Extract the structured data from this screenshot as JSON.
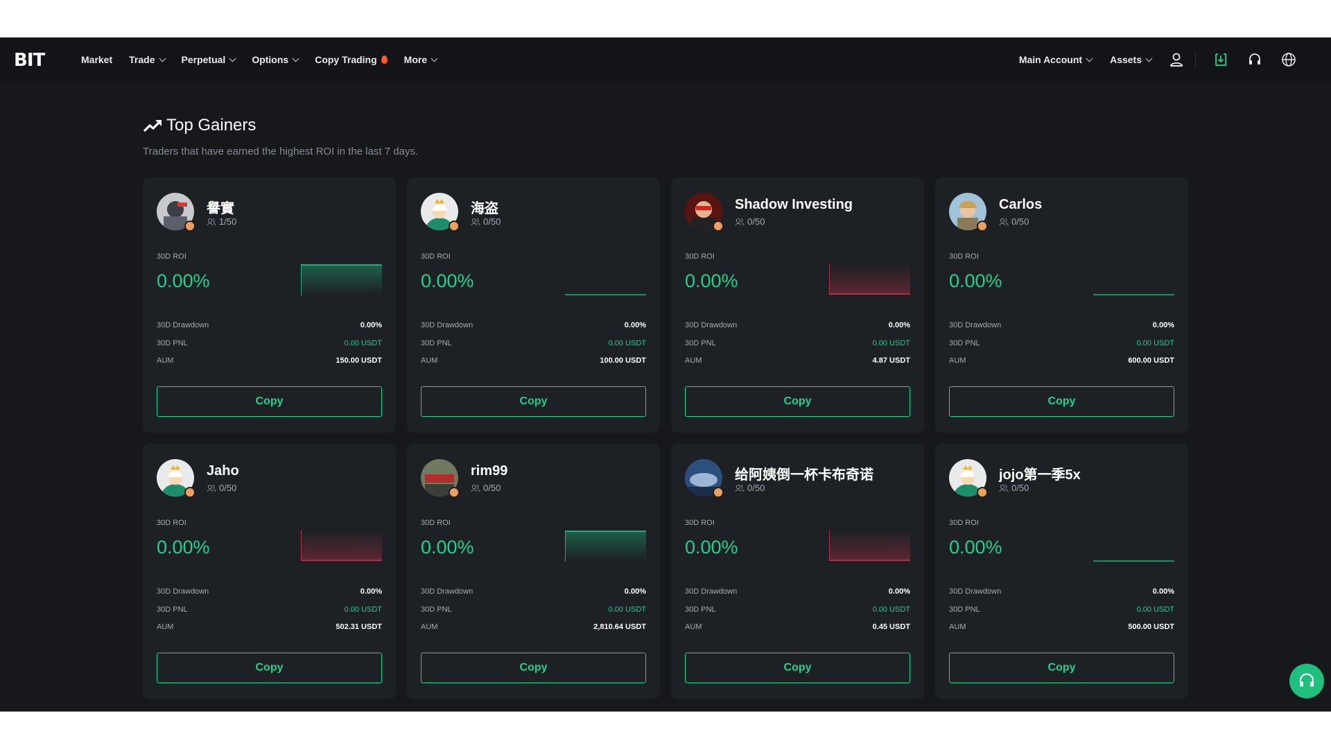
{
  "nav": {
    "logo": "BIT",
    "items": [
      {
        "label": "Market",
        "dropdown": false
      },
      {
        "label": "Trade",
        "dropdown": true
      },
      {
        "label": "Perpetual",
        "dropdown": true
      },
      {
        "label": "Options",
        "dropdown": true
      },
      {
        "label": "Copy Trading",
        "dropdown": false,
        "hot": true
      },
      {
        "label": "More",
        "dropdown": true
      }
    ],
    "right": {
      "main_account": "Main Account",
      "assets": "Assets"
    },
    "icons": [
      "user-icon",
      "deposit-icon",
      "headset-icon",
      "globe-icon"
    ]
  },
  "section": {
    "title": "Top Gainers",
    "subtitle": "Traders that have earned the highest ROI in the last 7 days."
  },
  "labels": {
    "roi": "30D ROI",
    "drawdown": "30D Drawdown",
    "pnl": "30D PNL",
    "aum": "AUM",
    "copy": "Copy"
  },
  "colors": {
    "accent": "#1fd28e",
    "negative": "#d0354c",
    "background": "#16181c",
    "card": "#1d2025"
  },
  "traders": [
    {
      "name": "譽實",
      "followers": "1/50",
      "roi": "0.00%",
      "drawdown": "0.00%",
      "pnl": "0.00 USDT",
      "aum": "150.00 USDT",
      "trend": "up",
      "avatar": "photo-avatar-dark"
    },
    {
      "name": "海盗",
      "followers": "0/50",
      "roi": "0.00%",
      "drawdown": "0.00%",
      "pnl": "0.00 USDT",
      "aum": "100.00 USDT",
      "trend": "flat",
      "avatar": "default-avatar"
    },
    {
      "name": "Shadow Investing",
      "followers": "0/50",
      "roi": "0.00%",
      "drawdown": "0.00%",
      "pnl": "0.00 USDT",
      "aum": "4.87 USDT",
      "trend": "down",
      "avatar": "photo-avatar-red"
    },
    {
      "name": "Carlos",
      "followers": "0/50",
      "roi": "0.00%",
      "drawdown": "0.00%",
      "pnl": "0.00 USDT",
      "aum": "600.00 USDT",
      "trend": "flat",
      "avatar": "photo-avatar-light"
    },
    {
      "name": "Jaho",
      "followers": "0/50",
      "roi": "0.00%",
      "drawdown": "0.00%",
      "pnl": "0.00 USDT",
      "aum": "502.31 USDT",
      "trend": "down",
      "avatar": "default-avatar"
    },
    {
      "name": "rim99",
      "followers": "0/50",
      "roi": "0.00%",
      "drawdown": "0.00%",
      "pnl": "0.00 USDT",
      "aum": "2,810.64 USDT",
      "trend": "up",
      "avatar": "photo-avatar-sign"
    },
    {
      "name": "给阿姨倒一杯卡布奇诺",
      "followers": "0/50",
      "roi": "0.00%",
      "drawdown": "0.00%",
      "pnl": "0.00 USDT",
      "aum": "0.45 USDT",
      "trend": "down",
      "avatar": "photo-avatar-blue"
    },
    {
      "name": "jojo第一季5x",
      "followers": "0/50",
      "roi": "0.00%",
      "drawdown": "0.00%",
      "pnl": "0.00 USDT",
      "aum": "500.00 USDT",
      "trend": "flat",
      "avatar": "default-avatar"
    }
  ]
}
